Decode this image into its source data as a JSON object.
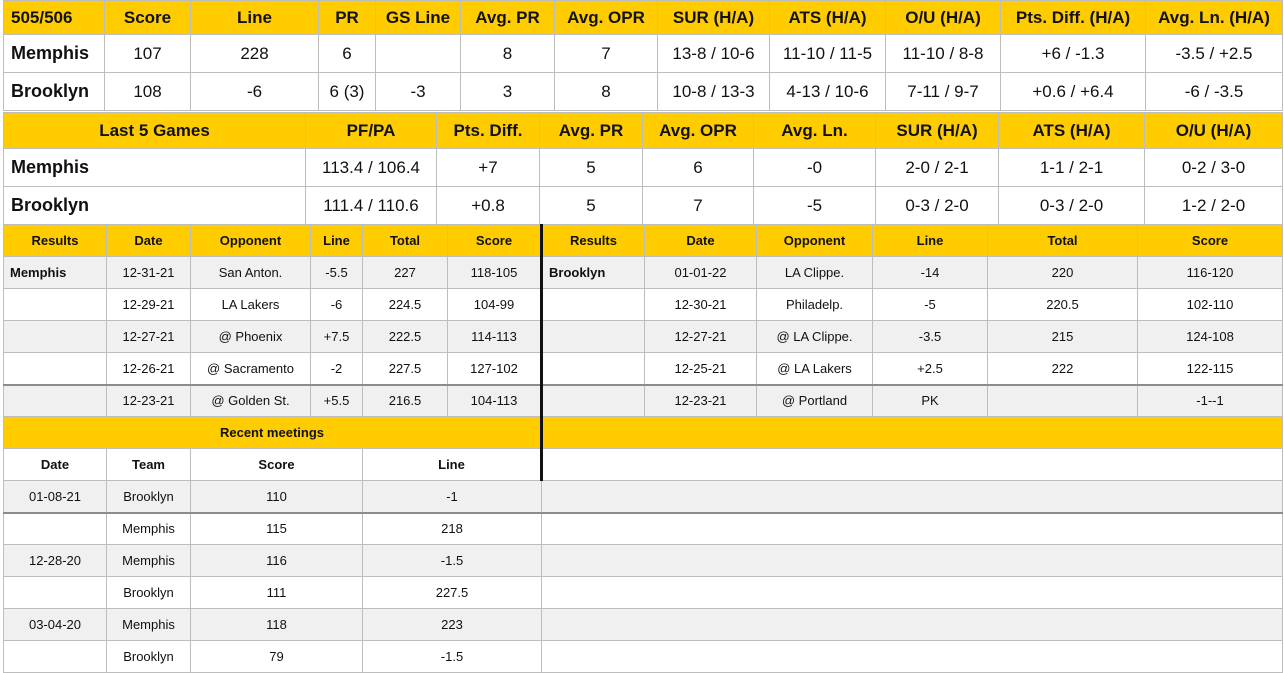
{
  "matchup": {
    "headers": [
      "505/506",
      "Score",
      "Line",
      "PR",
      "GS Line",
      "Avg. PR",
      "Avg. OPR",
      "SUR (H/A)",
      "ATS (H/A)",
      "O/U (H/A)",
      "Pts. Diff. (H/A)",
      "Avg. Ln. (H/A)"
    ],
    "rows": [
      [
        "Memphis",
        "107",
        "228",
        "6",
        "",
        "8",
        "7",
        "13-8 / 10-6",
        "11-10 / 11-5",
        "11-10 / 8-8",
        "+6 / -1.3",
        "-3.5 / +2.5"
      ],
      [
        "Brooklyn",
        "108",
        "-6",
        "6 (3)",
        "-3",
        "3",
        "8",
        "10-8 / 13-3",
        "4-13 / 10-6",
        "7-11 / 9-7",
        "+0.6 / +6.4",
        "-6 / -3.5"
      ]
    ]
  },
  "last5": {
    "headers": [
      "Last 5 Games",
      "PF/PA",
      "Pts. Diff.",
      "Avg. PR",
      "Avg. OPR",
      "Avg. Ln.",
      "SUR (H/A)",
      "ATS (H/A)",
      "O/U (H/A)"
    ],
    "rows": [
      [
        "Memphis",
        "113.4 / 106.4",
        "+7",
        "5",
        "6",
        "-0",
        "2-0 / 2-1",
        "1-1 / 2-1",
        "0-2 / 3-0"
      ],
      [
        "Brooklyn",
        "111.4 / 110.6",
        "+0.8",
        "5",
        "7",
        "-5",
        "0-3 / 2-0",
        "0-3 / 2-0",
        "1-2 / 2-0"
      ]
    ]
  },
  "results": {
    "headers": [
      "Results",
      "Date",
      "Opponent",
      "Line",
      "Total",
      "Score",
      "Results",
      "Date",
      "Opponent",
      "Line",
      "Total",
      "Score"
    ],
    "rows": [
      [
        "Memphis",
        "12-31-21",
        "San Anton.",
        "-5.5",
        "227",
        "118-105",
        "Brooklyn",
        "01-01-22",
        "LA Clippe.",
        "-14",
        "220",
        "116-120"
      ],
      [
        "",
        "12-29-21",
        "LA Lakers",
        "-6",
        "224.5",
        "104-99",
        "",
        "12-30-21",
        "Philadelp.",
        "-5",
        "220.5",
        "102-110"
      ],
      [
        "",
        "12-27-21",
        "@ Phoenix",
        "+7.5",
        "222.5",
        "114-113",
        "",
        "12-27-21",
        "@ LA Clippe.",
        "-3.5",
        "215",
        "124-108"
      ],
      [
        "",
        "12-26-21",
        "@ Sacramento",
        "-2",
        "227.5",
        "127-102",
        "",
        "12-25-21",
        "@ LA Lakers",
        "+2.5",
        "222",
        "122-115"
      ],
      [
        "",
        "12-23-21",
        "@ Golden St.",
        "+5.5",
        "216.5",
        "104-113",
        "",
        "12-23-21",
        "@ Portland",
        "PK",
        "",
        "-1--1"
      ]
    ]
  },
  "meetings": {
    "title": "Recent meetings",
    "headers": [
      "Date",
      "Team",
      "Score",
      "Line"
    ],
    "rows": [
      [
        "01-08-21",
        "Brooklyn",
        "110",
        "-1"
      ],
      [
        "",
        "Memphis",
        "115",
        "218"
      ],
      [
        "12-28-20",
        "Memphis",
        "116",
        "-1.5"
      ],
      [
        "",
        "Brooklyn",
        "111",
        "227.5"
      ],
      [
        "03-04-20",
        "Memphis",
        "118",
        "223"
      ],
      [
        "",
        "Brooklyn",
        "79",
        "-1.5"
      ]
    ]
  },
  "colors": {
    "header": "#ffcc00",
    "row_alt": "#f0f0f0",
    "border": "#bdbdbd"
  }
}
